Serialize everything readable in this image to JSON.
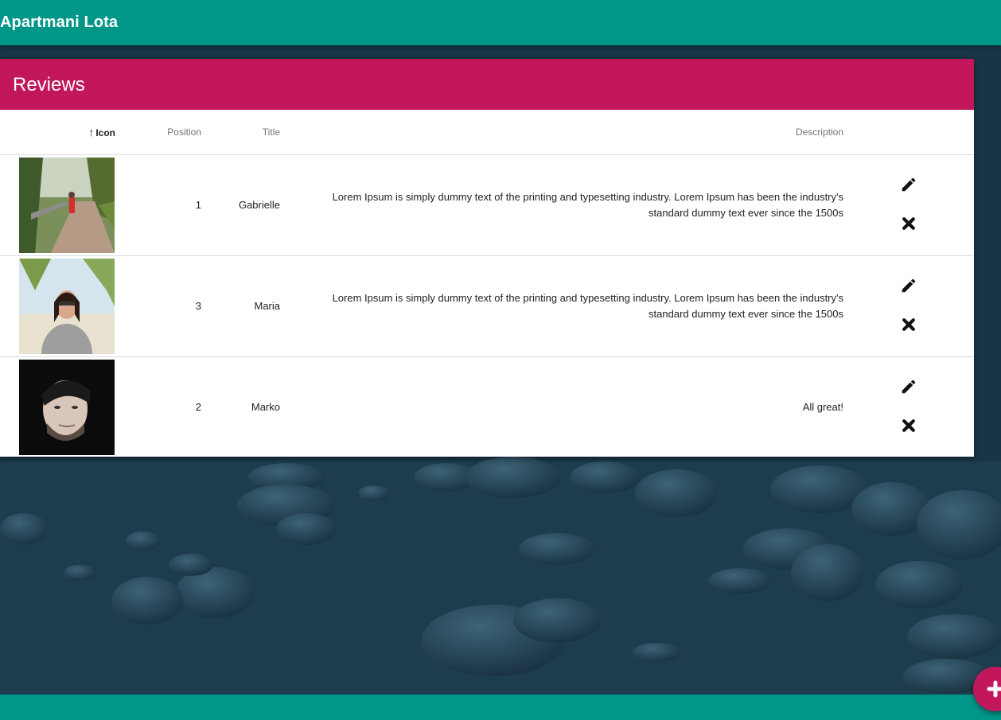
{
  "app": {
    "title": "Apartmani Lota"
  },
  "card": {
    "title": "Reviews"
  },
  "table": {
    "headers": {
      "icon": "Icon",
      "position": "Position",
      "title": "Title",
      "description": "Description"
    },
    "sort": {
      "column": "icon",
      "direction": "ascending"
    },
    "rows": [
      {
        "position": "1",
        "title": "Gabrielle",
        "description": "Lorem Ipsum is simply dummy text of the printing and typesetting industry. Lorem Ipsum has been the industry's standard dummy text ever since the 1500s",
        "image": "photo-garden-path"
      },
      {
        "position": "3",
        "title": "Maria",
        "description": "Lorem Ipsum is simply dummy text of the printing and typesetting industry. Lorem Ipsum has been the industry's standard dummy text ever since the 1500s",
        "image": "photo-woman-beach"
      },
      {
        "position": "2",
        "title": "Marko",
        "description": "All great!",
        "image": "photo-man-portrait"
      }
    ],
    "row_actions": [
      "edit-icon",
      "delete-icon"
    ]
  },
  "fab": {
    "icon": "plus-icon"
  },
  "colors": {
    "primary": "#009688",
    "accent": "#c2185b"
  }
}
